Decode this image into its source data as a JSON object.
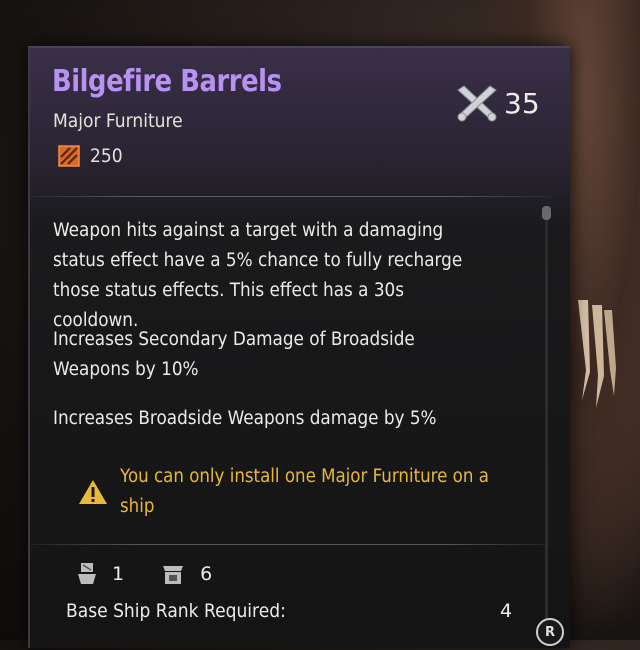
{
  "item": {
    "name": "Bilgefire Barrels",
    "category": "Major Furniture",
    "cost": "250",
    "power": "35",
    "name_color": "#b892f2"
  },
  "description": {
    "effect_1": "Weapon hits against a target with a damaging status effect have a 5% chance to fully recharge those status effects. This effect has a 30s cooldown.",
    "effect_2": "Increases Secondary Damage of Broadside Weapons by 10%",
    "effect_3": "Increases Broadside Weapons damage by 5%"
  },
  "warning": {
    "text": "You can only install one Major Furniture on a ship",
    "color": "#e8b93a",
    "icon": "warning-triangle-icon"
  },
  "stats": {
    "ship_slot_value": "1",
    "shop_slot_value": "6",
    "rank_label": "Base Ship Rank Required:",
    "rank_value": "4"
  },
  "controls": {
    "r_button_label": "R"
  },
  "icons": {
    "cost": "material-crate-icon",
    "power": "crossed-cannons-icon",
    "ship": "ship-icon",
    "shop": "shop-icon"
  }
}
